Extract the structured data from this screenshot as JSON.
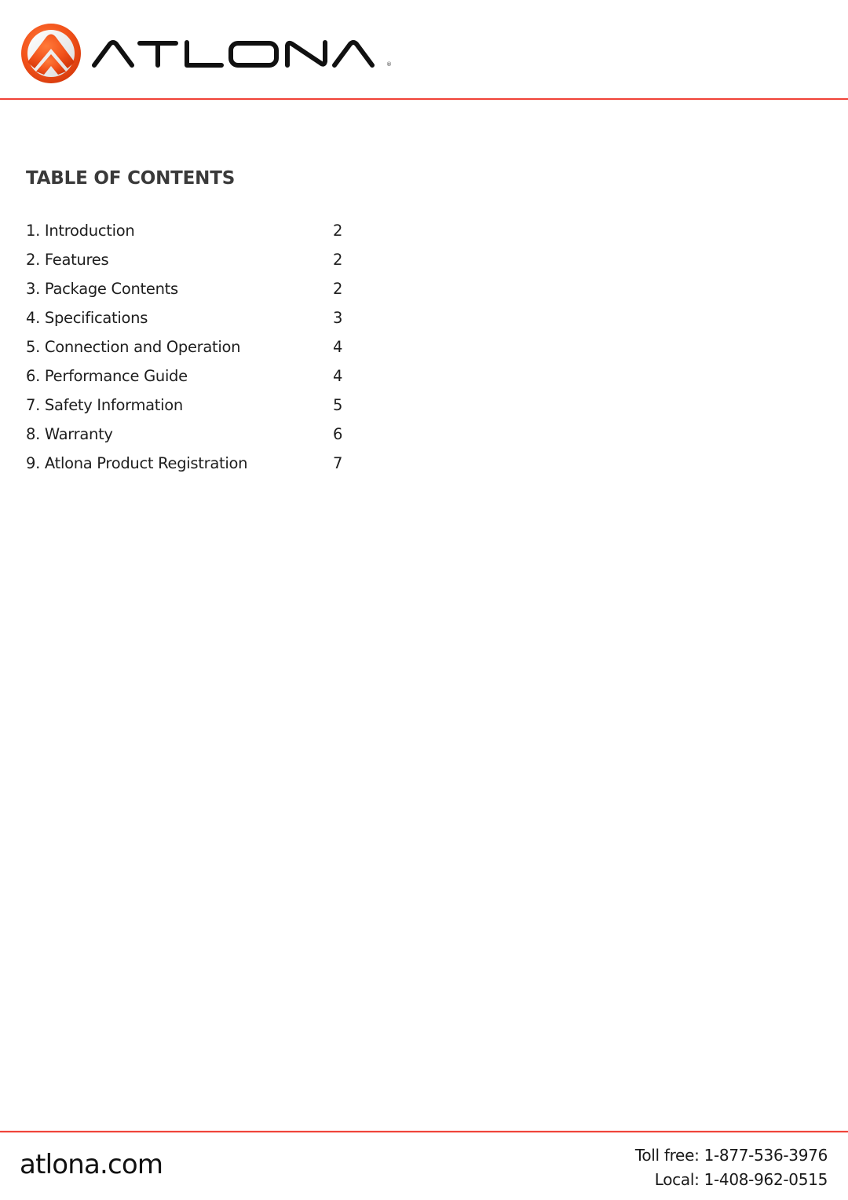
{
  "brand": {
    "name": "ATLONA",
    "registered_mark": "®",
    "colors": {
      "accent": "#f0443a",
      "logo_orange": "#f25a1c",
      "wordmark": "#111111"
    }
  },
  "toc": {
    "title": "TABLE OF CONTENTS",
    "items": [
      {
        "label": "1. Introduction",
        "page": "2"
      },
      {
        "label": "2. Features",
        "page": "2"
      },
      {
        "label": "3. Package Contents",
        "page": "2"
      },
      {
        "label": "4. Specifications",
        "page": "3"
      },
      {
        "label": "5. Connection and Operation",
        "page": "4"
      },
      {
        "label": "6. Performance Guide",
        "page": "4"
      },
      {
        "label": "7. Safety Information",
        "page": "5"
      },
      {
        "label": "8. Warranty",
        "page": "6"
      },
      {
        "label": "9. Atlona Product Registration",
        "page": "7"
      }
    ]
  },
  "footer": {
    "website": "atlona.com",
    "toll_free": "Toll free: 1-877-536-3976",
    "local": "Local: 1-408-962-0515"
  }
}
